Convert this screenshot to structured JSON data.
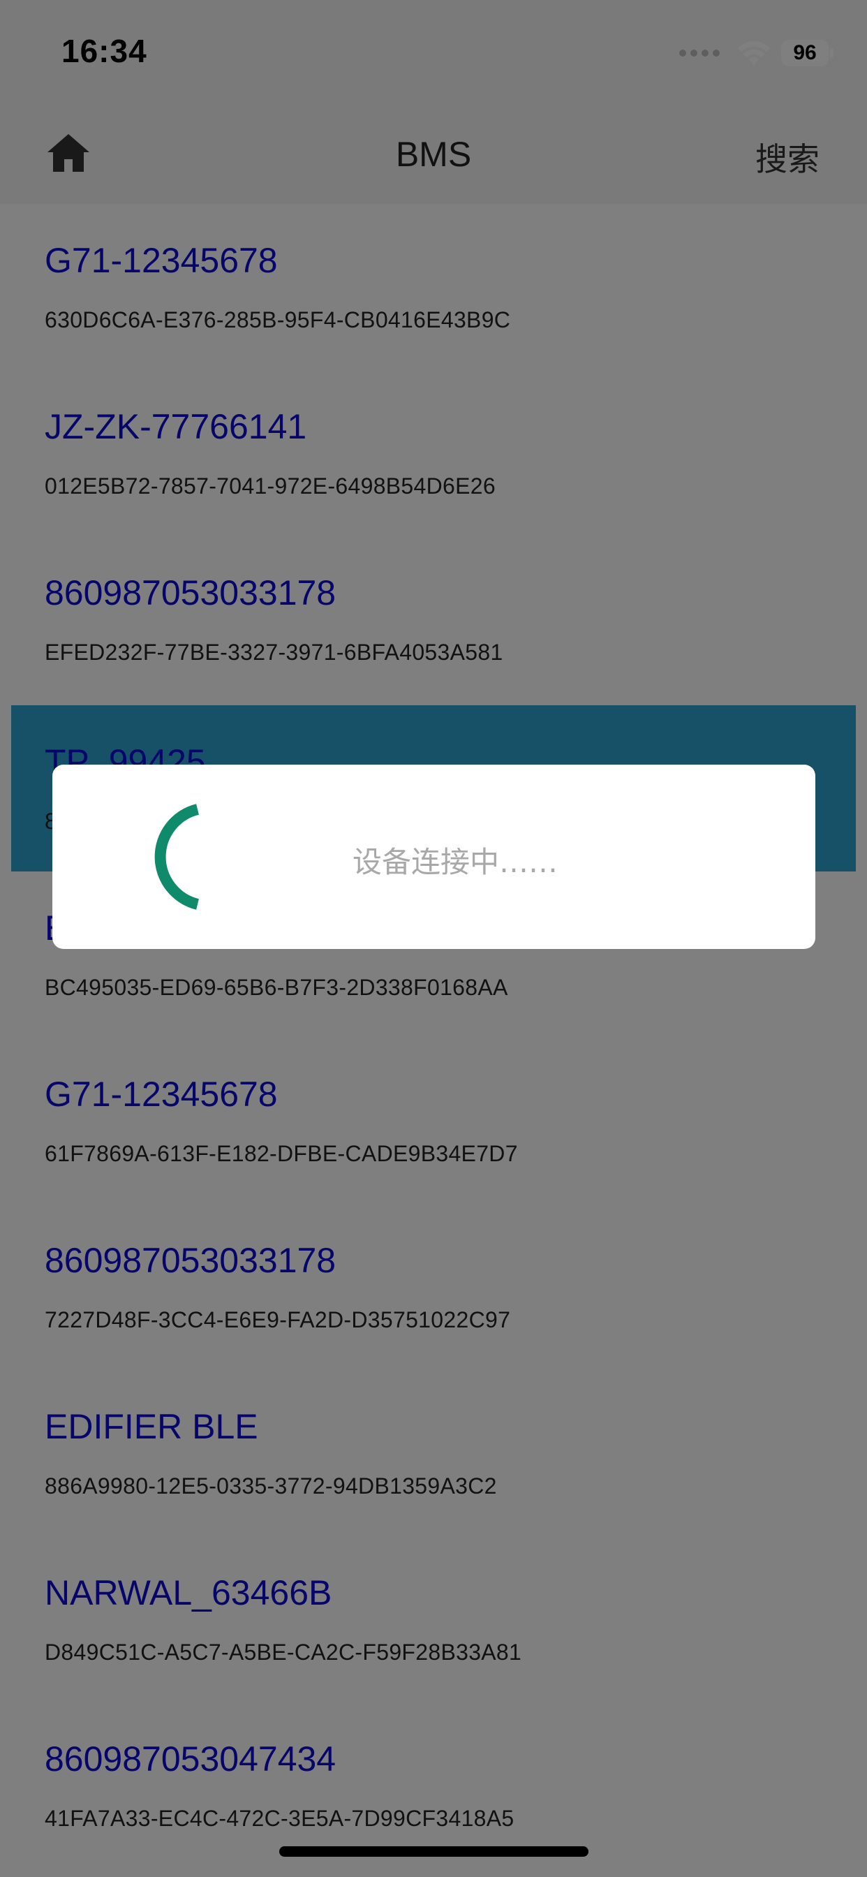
{
  "status_bar": {
    "time": "16:34",
    "battery": "96",
    "icons": [
      "signal-dots-icon",
      "wifi-icon",
      "battery-icon"
    ]
  },
  "nav": {
    "title": "BMS",
    "search_label": "搜索",
    "home_icon": "home-icon"
  },
  "devices": [
    {
      "name": "G71-12345678",
      "uuid": "630D6C6A-E376-285B-95F4-CB0416E43B9C"
    },
    {
      "name": "JZ-ZK-77766141",
      "uuid": "012E5B72-7857-7041-972E-6498B54D6E26"
    },
    {
      "name": "860987053033178",
      "uuid": "EFED232F-77BE-3327-3971-6BFA4053A581"
    },
    {
      "name": "TP_99425",
      "uuid": "8"
    },
    {
      "name": "E",
      "uuid": "BC495035-ED69-65B6-B7F3-2D338F0168AA"
    },
    {
      "name": "G71-12345678",
      "uuid": "61F7869A-613F-E182-DFBE-CADE9B34E7D7"
    },
    {
      "name": "860987053033178",
      "uuid": "7227D48F-3CC4-E6E9-FA2D-D35751022C97"
    },
    {
      "name": "EDIFIER BLE",
      "uuid": "886A9980-12E5-0335-3772-94DB1359A3C2"
    },
    {
      "name": "NARWAL_63466B",
      "uuid": "D849C51C-A5C7-A5BE-CA2C-F59F28B33A81"
    },
    {
      "name": "860987053047434",
      "uuid": "41FA7A33-EC4C-472C-3E5A-7D99CF3418A5"
    }
  ],
  "loading": {
    "text": "设备连接中……",
    "spinner_color": "#0f8a6a"
  },
  "colors": {
    "device_name": "#0b0bd6",
    "selected_row": "#2ea3d0"
  }
}
